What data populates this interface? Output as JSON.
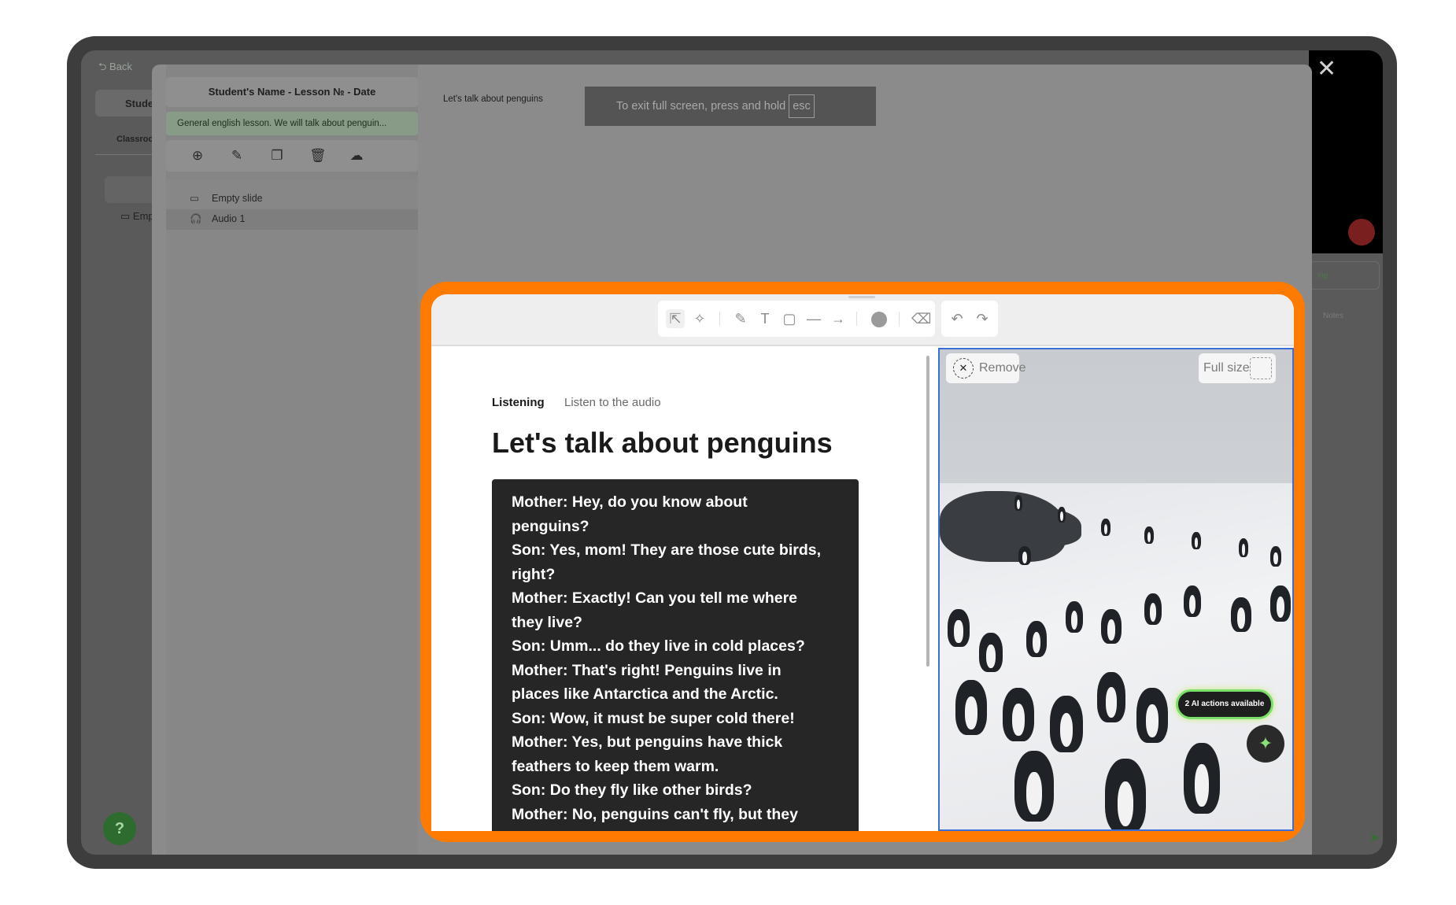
{
  "background": {
    "back_label": "Back",
    "student_tab": "Student",
    "classroom_tab": "Classroo",
    "empty_item": "Emp",
    "help_label": "?",
    "close_label": "✕",
    "live_label": "ing",
    "notes_label": "Notes"
  },
  "lesson": {
    "title": "Student's Name - Lesson № - Date",
    "description": "General english lesson. We will talk about penguin...",
    "tools": [
      "add-icon",
      "edit-icon",
      "duplicate-icon",
      "delete-icon",
      "upload-icon"
    ],
    "slides": [
      {
        "label": "Empty slide",
        "icon": "monitor-icon"
      },
      {
        "label": "Audio 1",
        "icon": "headphones-icon"
      }
    ],
    "breadcrumb": "Let's talk about penguins"
  },
  "fullscreen_banner": {
    "text": "To exit full screen, press and hold",
    "key": "esc"
  },
  "drawing_toolbar": {
    "tools": [
      "pointer-icon",
      "magic-wand-icon",
      "pencil-icon",
      "text-icon",
      "rectangle-icon",
      "line-icon",
      "arrow-icon",
      "color-icon",
      "eraser-icon",
      "undo-icon",
      "redo-icon"
    ]
  },
  "activity": {
    "type_label": "Listening",
    "instruction": "Listen to the audio",
    "heading": "Let's talk about penguins",
    "transcript": [
      "Mother: Hey, do you know about penguins?",
      "Son: Yes, mom! They are those cute birds, right?",
      "Mother: Exactly! Can you tell me where they live?",
      "Son: Umm... do they live in cold places?",
      "Mother: That's right! Penguins live in places like Antarctica and the Arctic.",
      "Son: Wow, it must be super cold there!",
      "Mother: Yes, but penguins have thick feathers to keep them warm.",
      "Son: Do they fly like other birds?",
      "Mother: No, penguins can't fly, but they"
    ]
  },
  "image_panel": {
    "remove_label": "Remove",
    "fullsize_label": "Full size",
    "ai_actions_label": "2 AI actions available",
    "accent_color": "#3a6fd8",
    "highlight_color": "#ff7a00"
  }
}
